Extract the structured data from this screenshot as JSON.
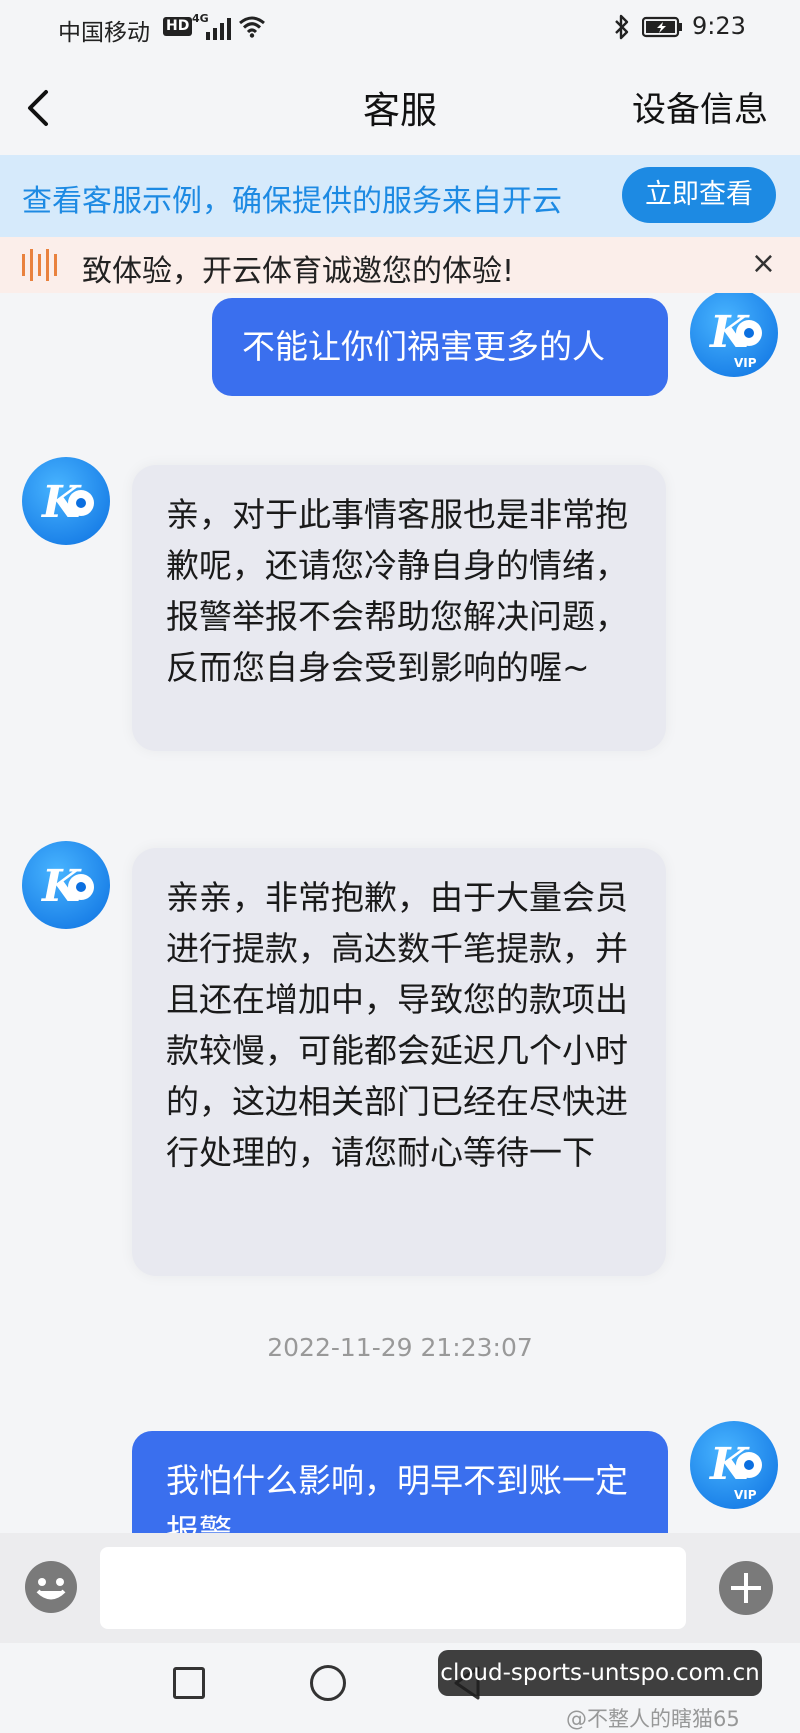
{
  "status_bar": {
    "carrier": "中国移动",
    "hd": "HD",
    "network": "4G",
    "time": "9:23"
  },
  "nav": {
    "title": "客服",
    "right_action": "设备信息"
  },
  "banner": {
    "text": "查看客服示例，确保提供的服务来自开云",
    "button": "立即查看"
  },
  "notice": {
    "text": "致体验，开云体育诚邀您的体验!",
    "close": "×"
  },
  "chat": {
    "messages": [
      {
        "sender": "user",
        "avatar_badge": "VIP",
        "text": "不能让你们祸害更多的人"
      },
      {
        "sender": "agent",
        "text": "亲，对于此事情客服也是非常抱歉呢，还请您冷静自身的情绪，报警举报不会帮助您解决问题，反而您自身会受到影响的喔~"
      },
      {
        "sender": "agent",
        "text": "亲亲，非常抱歉，由于大量会员进行提款，高达数千笔提款，并且还在增加中，导致您的款项出款较慢，可能都会延迟几个小时的，这边相关部门已经在尽快进行处理的，请您耐心等待一下"
      },
      {
        "sender": "user",
        "avatar_badge": "VIP",
        "text": "我怕什么影响，明早不到账一定报警"
      }
    ],
    "timestamp": "2022-11-29 21:23:07"
  },
  "input": {
    "value": "",
    "placeholder": ""
  },
  "overlay": {
    "url": "cloud-sports-untspo.com.cn",
    "watermark": "@不整人的瞎猫65"
  },
  "colors": {
    "accent": "#1d8ae3",
    "user_bubble": "#3a6fee",
    "agent_bubble": "#e8e9f0"
  }
}
